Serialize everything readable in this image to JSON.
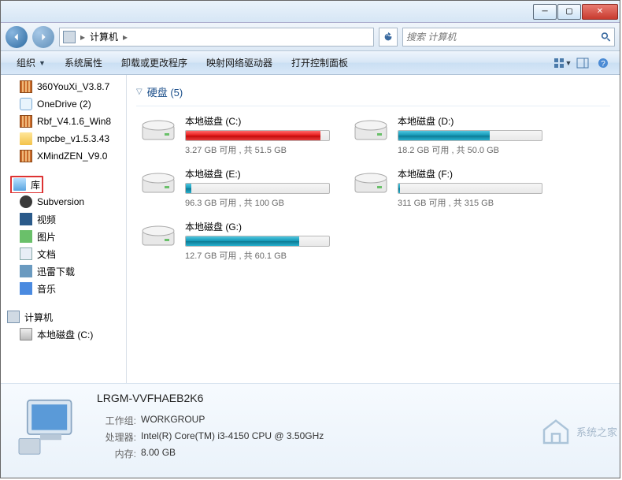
{
  "breadcrumb": {
    "root_icon": "computer",
    "current": "计算机",
    "sep": "▸"
  },
  "search": {
    "placeholder": "搜索 计算机"
  },
  "toolbar": {
    "organize": "组织",
    "system_props": "系统属性",
    "uninstall": "卸载或更改程序",
    "map_drive": "映射网络驱动器",
    "control_panel": "打开控制面板"
  },
  "sidebar": {
    "favorites": [
      {
        "icon": "zip",
        "label": "360YouXi_V3.8.7"
      },
      {
        "icon": "cloud",
        "label": "OneDrive (2)"
      },
      {
        "icon": "zip",
        "label": "Rbf_V4.1.6_Win8"
      },
      {
        "icon": "folder",
        "label": "mpcbe_v1.5.3.43"
      },
      {
        "icon": "zip",
        "label": "XMindZEN_V9.0"
      }
    ],
    "libraries_label": "库",
    "libraries": [
      {
        "icon": "svn",
        "label": "Subversion"
      },
      {
        "icon": "video",
        "label": "视频"
      },
      {
        "icon": "pic",
        "label": "图片"
      },
      {
        "icon": "doc",
        "label": "文档"
      },
      {
        "icon": "dl",
        "label": "迅雷下载"
      },
      {
        "icon": "music",
        "label": "音乐"
      }
    ],
    "computer_label": "计算机",
    "computer_children": [
      {
        "icon": "drive-s",
        "label": "本地磁盘 (C:)"
      }
    ]
  },
  "content": {
    "group_title": "硬盘 (5)",
    "drives": [
      {
        "name": "本地磁盘 (C:)",
        "free": "3.27 GB 可用",
        "total": "共 51.5 GB",
        "fill_pct": 94,
        "warn": true
      },
      {
        "name": "本地磁盘 (D:)",
        "free": "18.2 GB 可用",
        "total": "共 50.0 GB",
        "fill_pct": 64,
        "warn": false
      },
      {
        "name": "本地磁盘 (E:)",
        "free": "96.3 GB 可用",
        "total": "共 100 GB",
        "fill_pct": 4,
        "warn": false
      },
      {
        "name": "本地磁盘 (F:)",
        "free": "311 GB 可用",
        "total": "共 315 GB",
        "fill_pct": 1,
        "warn": false
      },
      {
        "name": "本地磁盘 (G:)",
        "free": "12.7 GB 可用",
        "total": "共 60.1 GB",
        "fill_pct": 79,
        "warn": false
      }
    ]
  },
  "details": {
    "name": "LRGM-VVFHAEB2K6",
    "workgroup_label": "工作组:",
    "workgroup": "WORKGROUP",
    "cpu_label": "处理器:",
    "cpu": "Intel(R) Core(TM) i3-4150 CPU @ 3.50GHz",
    "mem_label": "内存:",
    "mem": "8.00 GB"
  },
  "watermark": "系统之家"
}
